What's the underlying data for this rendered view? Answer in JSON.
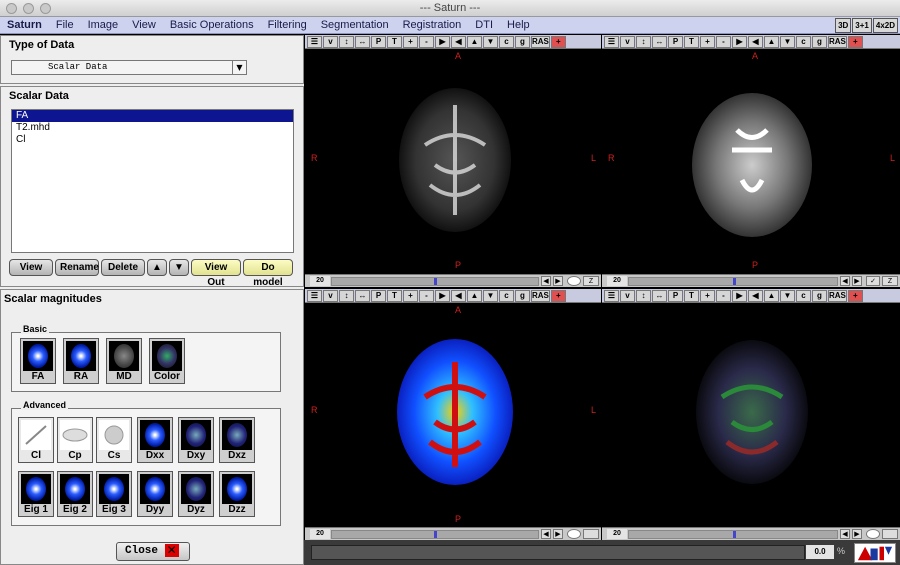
{
  "window": {
    "title": "--- Saturn ---"
  },
  "menu": {
    "items": [
      "Saturn",
      "File",
      "Image",
      "View",
      "Basic Operations",
      "Filtering",
      "Segmentation",
      "Registration",
      "DTI",
      "Help"
    ]
  },
  "layout_buttons": [
    "3D",
    "3+1",
    "4x2D"
  ],
  "type_panel": {
    "title": "Type of Data",
    "selected": "Scalar Data"
  },
  "scalar_panel": {
    "title": "Scalar Data",
    "items": [
      "FA",
      "T2.mhd",
      "Cl"
    ],
    "selected_index": 0,
    "buttons": [
      "View",
      "Rename",
      "Delete",
      "▲",
      "▼",
      "View Out",
      "Do model"
    ]
  },
  "magnitudes_panel": {
    "title": "Scalar magnitudes",
    "basic_label": "Basic",
    "basic": [
      "FA",
      "RA",
      "MD",
      "Color"
    ],
    "advanced_label": "Advanced",
    "advanced": [
      "Cl",
      "Cp",
      "Cs",
      "Dxx",
      "Dxy",
      "Dxz",
      "Eig 1",
      "Eig 2",
      "Eig 3",
      "Dyy",
      "Dyz",
      "Dzz"
    ],
    "close_label": "Close"
  },
  "viewer_toolbar": [
    "☰",
    "v",
    "↕",
    "↔",
    "P",
    "T",
    "+",
    "-",
    "▶",
    "◀",
    "▲",
    "▼",
    "c",
    "g",
    "RAS",
    "+"
  ],
  "orientation": {
    "top": "A",
    "bottom": "P",
    "left": "R",
    "right": "L"
  },
  "slice_numbers": [
    "20",
    "20",
    "20",
    "20"
  ],
  "axis_select": "Z",
  "status": {
    "value": "0.0",
    "percent": "%"
  },
  "colors": {
    "menu_bg": "#cdd3ee",
    "selection": "#0d1690",
    "orient": "#d02020"
  }
}
